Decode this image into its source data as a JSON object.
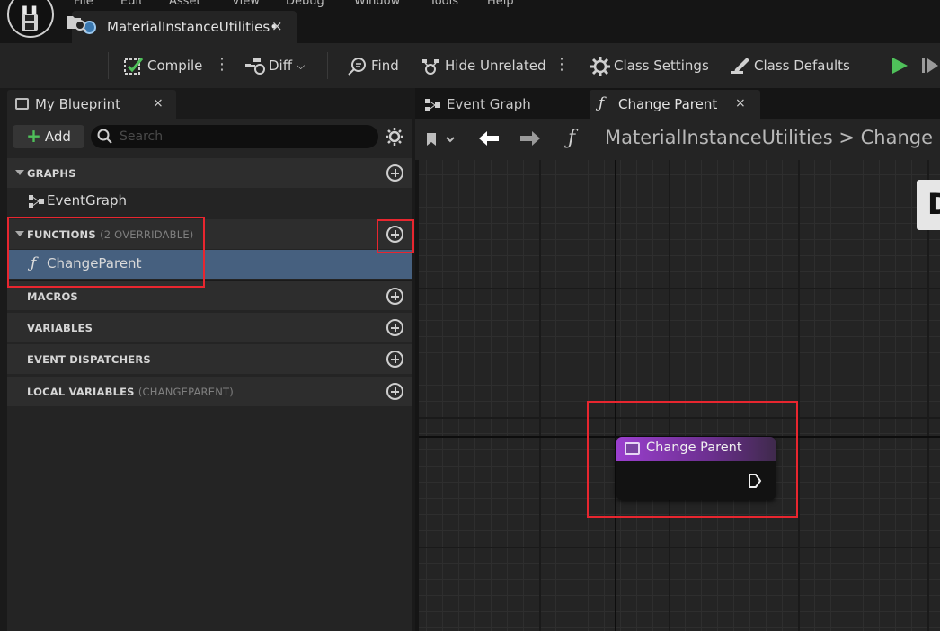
{
  "menu": [
    "File",
    "Edit",
    "Asset",
    "View",
    "Debug",
    "Window",
    "Tools",
    "Help"
  ],
  "document_tab": {
    "title": "MaterialInstanceUtilities•",
    "close": "×"
  },
  "toolbar": {
    "compile_label": "Compile",
    "diff_label": "Diff",
    "find_label": "Find",
    "hide_unrelated_label": "Hide Unrelated",
    "class_settings_label": "Class Settings",
    "class_defaults_label": "Class Defaults"
  },
  "my_blueprint": {
    "tab_label": "My Blueprint",
    "close": "×",
    "add_label": "Add",
    "search_placeholder": "Search",
    "sections": {
      "graphs": "GRAPHS",
      "functions": "FUNCTIONS",
      "functions_sub": "(2 OVERRIDABLE)",
      "macros": "MACROS",
      "variables": "VARIABLES",
      "event_dispatchers": "EVENT DISPATCHERS",
      "local_variables": "LOCAL VARIABLES",
      "local_variables_sub": "(CHANGEPARENT)"
    },
    "graph_items": [
      "EventGraph"
    ],
    "function_items": [
      "ChangeParent"
    ]
  },
  "graph_tabs": [
    {
      "label": "Event Graph"
    },
    {
      "label": "Change Parent",
      "close": "×"
    }
  ],
  "breadcrumb": {
    "fn_glyph": "ƒ",
    "text": "MaterialInstanceUtilities > Change Pa"
  },
  "canvas_corner_letter": "D",
  "node": {
    "title": "Change Parent"
  },
  "colors": {
    "accent_selected": "#46607f",
    "highlight_red": "#e8262f",
    "node_header": "#9b3fcf",
    "add_plus": "#4fc05a",
    "play": "#4fc05a"
  },
  "icons": [
    "save-icon",
    "browse-icon",
    "compile-icon",
    "diff-icon",
    "find-icon",
    "hide-unrelated-icon",
    "class-settings-icon",
    "class-defaults-icon",
    "play-icon",
    "step-icon",
    "search-icon",
    "gear-icon"
  ]
}
